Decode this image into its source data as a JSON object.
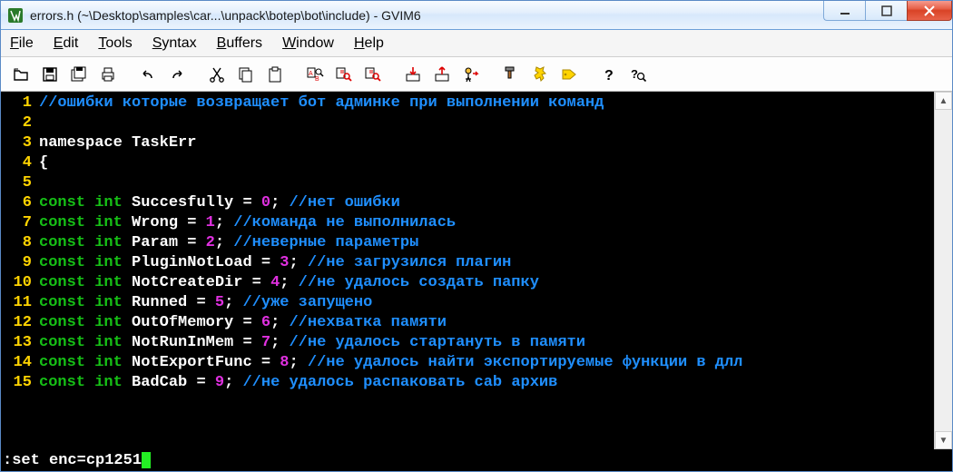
{
  "window": {
    "title": "errors.h (~\\Desktop\\samples\\car...\\unpack\\botep\\bot\\include) - GVIM6"
  },
  "menu": {
    "file": "File",
    "edit": "Edit",
    "tools": "Tools",
    "syntax": "Syntax",
    "buffers": "Buffers",
    "window": "Window",
    "help": "Help"
  },
  "cmdline": ":set enc=cp1251",
  "code": {
    "lines": [
      {
        "n": "1",
        "content": [
          {
            "cls": "c-comment",
            "t": "//ошибки которые возвращает бот админке при выполнении команд"
          }
        ]
      },
      {
        "n": "2",
        "content": []
      },
      {
        "n": "3",
        "content": [
          {
            "cls": "c-id",
            "t": "namespace TaskErr"
          }
        ]
      },
      {
        "n": "4",
        "content": [
          {
            "cls": "c-punc",
            "t": "{"
          }
        ]
      },
      {
        "n": "5",
        "content": []
      },
      {
        "n": "6",
        "content": [
          {
            "cls": "c-kw",
            "t": "const "
          },
          {
            "cls": "c-type",
            "t": "int"
          },
          {
            "cls": "c-id",
            "t": " Succesfully = "
          },
          {
            "cls": "c-num",
            "t": "0"
          },
          {
            "cls": "c-punc",
            "t": "; "
          },
          {
            "cls": "c-comment",
            "t": "//нет ошибки"
          }
        ]
      },
      {
        "n": "7",
        "content": [
          {
            "cls": "c-kw",
            "t": "const "
          },
          {
            "cls": "c-type",
            "t": "int"
          },
          {
            "cls": "c-id",
            "t": " Wrong = "
          },
          {
            "cls": "c-num",
            "t": "1"
          },
          {
            "cls": "c-punc",
            "t": "; "
          },
          {
            "cls": "c-comment",
            "t": "//команда не выполнилась"
          }
        ]
      },
      {
        "n": "8",
        "content": [
          {
            "cls": "c-kw",
            "t": "const "
          },
          {
            "cls": "c-type",
            "t": "int"
          },
          {
            "cls": "c-id",
            "t": " Param = "
          },
          {
            "cls": "c-num",
            "t": "2"
          },
          {
            "cls": "c-punc",
            "t": "; "
          },
          {
            "cls": "c-comment",
            "t": "//неверные параметры"
          }
        ]
      },
      {
        "n": "9",
        "content": [
          {
            "cls": "c-kw",
            "t": "const "
          },
          {
            "cls": "c-type",
            "t": "int"
          },
          {
            "cls": "c-id",
            "t": " PluginNotLoad = "
          },
          {
            "cls": "c-num",
            "t": "3"
          },
          {
            "cls": "c-punc",
            "t": "; "
          },
          {
            "cls": "c-comment",
            "t": "//не загрузился плагин"
          }
        ]
      },
      {
        "n": "10",
        "content": [
          {
            "cls": "c-kw",
            "t": "const "
          },
          {
            "cls": "c-type",
            "t": "int"
          },
          {
            "cls": "c-id",
            "t": " NotCreateDir = "
          },
          {
            "cls": "c-num",
            "t": "4"
          },
          {
            "cls": "c-punc",
            "t": "; "
          },
          {
            "cls": "c-comment",
            "t": "//не удалось создать папку"
          }
        ]
      },
      {
        "n": "11",
        "content": [
          {
            "cls": "c-kw",
            "t": "const "
          },
          {
            "cls": "c-type",
            "t": "int"
          },
          {
            "cls": "c-id",
            "t": " Runned = "
          },
          {
            "cls": "c-num",
            "t": "5"
          },
          {
            "cls": "c-punc",
            "t": "; "
          },
          {
            "cls": "c-comment",
            "t": "//уже запущено"
          }
        ]
      },
      {
        "n": "12",
        "content": [
          {
            "cls": "c-kw",
            "t": "const "
          },
          {
            "cls": "c-type",
            "t": "int"
          },
          {
            "cls": "c-id",
            "t": " OutOfMemory = "
          },
          {
            "cls": "c-num",
            "t": "6"
          },
          {
            "cls": "c-punc",
            "t": "; "
          },
          {
            "cls": "c-comment",
            "t": "//нехватка памяти"
          }
        ]
      },
      {
        "n": "13",
        "content": [
          {
            "cls": "c-kw",
            "t": "const "
          },
          {
            "cls": "c-type",
            "t": "int"
          },
          {
            "cls": "c-id",
            "t": " NotRunInMem = "
          },
          {
            "cls": "c-num",
            "t": "7"
          },
          {
            "cls": "c-punc",
            "t": "; "
          },
          {
            "cls": "c-comment",
            "t": "//не удалось стартануть в памяти"
          }
        ]
      },
      {
        "n": "14",
        "content": [
          {
            "cls": "c-kw",
            "t": "const "
          },
          {
            "cls": "c-type",
            "t": "int"
          },
          {
            "cls": "c-id",
            "t": " NotExportFunc = "
          },
          {
            "cls": "c-num",
            "t": "8"
          },
          {
            "cls": "c-punc",
            "t": "; "
          },
          {
            "cls": "c-comment",
            "t": "//не удалось найти экспортируемые функции в длл"
          }
        ]
      },
      {
        "n": "15",
        "content": [
          {
            "cls": "c-kw",
            "t": "const "
          },
          {
            "cls": "c-type",
            "t": "int"
          },
          {
            "cls": "c-id",
            "t": " BadCab = "
          },
          {
            "cls": "c-num",
            "t": "9"
          },
          {
            "cls": "c-punc",
            "t": "; "
          },
          {
            "cls": "c-comment",
            "t": "//не удалось распаковать cab архив"
          }
        ]
      }
    ]
  },
  "toolbar_icons": [
    "open-icon",
    "save-icon",
    "save-all-icon",
    "print-icon",
    "sep",
    "undo-icon",
    "redo-icon",
    "sep",
    "cut-icon",
    "copy-icon",
    "paste-icon",
    "sep",
    "find-replace-icon",
    "find-next-icon",
    "find-prev-icon",
    "sep",
    "session-load-icon",
    "session-save-icon",
    "run-script-icon",
    "sep",
    "make-icon",
    "shell-icon",
    "tags-icon",
    "sep",
    "help-icon",
    "find-help-icon"
  ]
}
